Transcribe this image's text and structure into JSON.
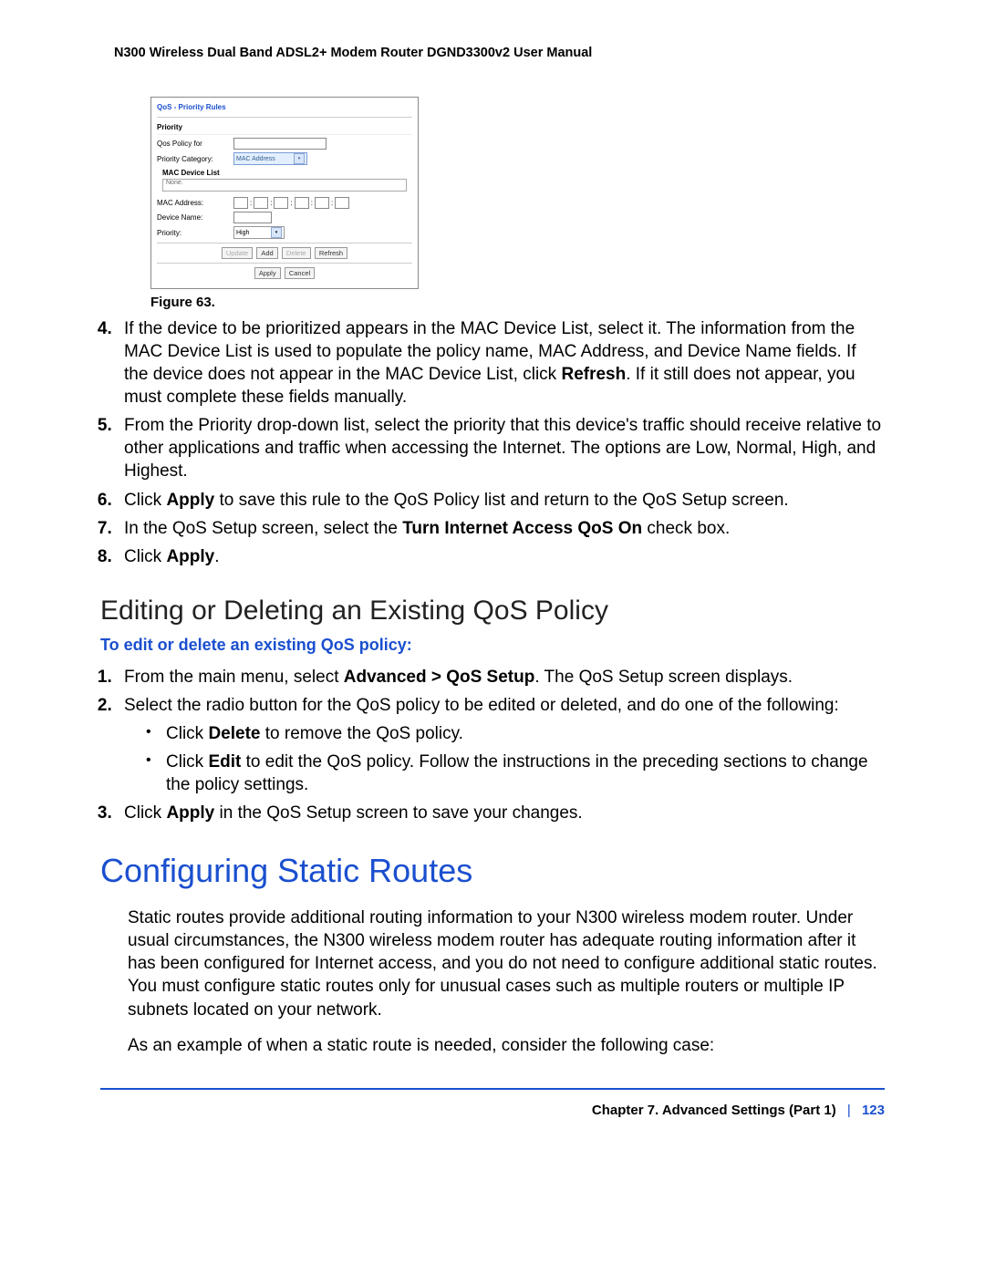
{
  "header": "N300 Wireless Dual Band ADSL2+ Modem Router DGND3300v2 User Manual",
  "screenshot": {
    "title": "QoS - Priority Rules",
    "priority_hdr": "Priority",
    "row_policy_lbl": "Qos Policy for",
    "row_category_lbl": "Priority Category:",
    "row_category_val": "MAC Address",
    "mac_list_hdr": "MAC Device List",
    "mac_list_none": "None.",
    "mac_addr_lbl": "MAC Address:",
    "device_name_lbl": "Device Name:",
    "priority_lbl": "Priority:",
    "priority_val": "High",
    "btn_update": "Update",
    "btn_add": "Add",
    "btn_delete": "Delete",
    "btn_refresh": "Refresh",
    "btn_apply": "Apply",
    "btn_cancel": "Cancel"
  },
  "fig_caption": "Figure 63.",
  "steps_a": {
    "s4a": "If the device to be prioritized appears in the MAC Device List, select it. The information from the MAC Device List is used to populate the policy name, MAC Address, and Device Name fields. If the device does not appear in the MAC Device List, click ",
    "s4b": "Refresh",
    "s4c": ". If it still does not appear, you must complete these fields manually.",
    "s5": "From the Priority drop-down list, select the priority that this device's traffic should receive relative to other applications and traffic when accessing the Internet. The options are Low, Normal, High, and Highest.",
    "s6a": "Click ",
    "s6b": "Apply",
    "s6c": " to save this rule to the QoS Policy list and return to the QoS Setup screen.",
    "s7a": "In the QoS Setup screen, select the ",
    "s7b": "Turn Internet Access QoS On",
    "s7c": " check box.",
    "s8a": "Click ",
    "s8b": "Apply",
    "s8c": "."
  },
  "h2_editdel": "Editing or Deleting an Existing QoS Policy",
  "instr_head": "To edit or delete an existing QoS policy:",
  "steps_b": {
    "s1a": "From the main menu, select ",
    "s1b": "Advanced > QoS Setup",
    "s1c": ". The QoS Setup screen displays.",
    "s2": "Select the radio button for the QoS policy to be edited or deleted, and do one of the following:",
    "b1a": "Click ",
    "b1b": "Delete",
    "b1c": " to remove the QoS policy.",
    "b2a": "Click ",
    "b2b": "Edit",
    "b2c": " to edit the QoS policy. Follow the instructions in the preceding sections to change the policy settings.",
    "s3a": "Click ",
    "s3b": "Apply",
    "s3c": " in the QoS Setup screen to save your changes."
  },
  "h1_routes": "Configuring Static Routes",
  "para1": "Static routes provide additional routing information to your N300 wireless modem router. Under usual circumstances, the N300 wireless modem router has adequate routing information after it has been configured for Internet access, and you do not need to configure additional static routes. You must configure static routes only for unusual cases such as multiple routers or multiple IP subnets located on your network.",
  "para2": "As an example of when a static route is needed, consider the following case:",
  "footer": {
    "chapter": "Chapter 7.  Advanced Settings (Part 1)",
    "page": "123"
  }
}
